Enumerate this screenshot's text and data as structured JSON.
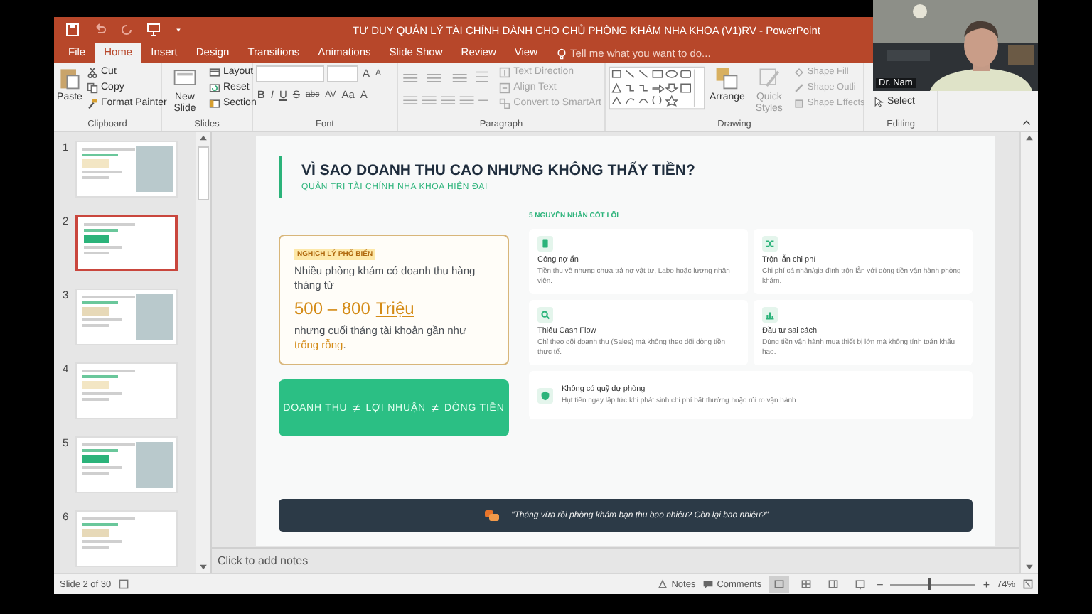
{
  "title_bar": {
    "title": "TƯ DUY QUẢN LÝ TÀI CHÍNH DÀNH CHO CHỦ PHÒNG KHÁM NHA KHOA (V1)RV - PowerPoint"
  },
  "tabs": [
    {
      "label": "File",
      "selected": false
    },
    {
      "label": "Home",
      "selected": true
    },
    {
      "label": "Insert",
      "selected": false
    },
    {
      "label": "Design",
      "selected": false
    },
    {
      "label": "Transitions",
      "selected": false
    },
    {
      "label": "Animations",
      "selected": false
    },
    {
      "label": "Slide Show",
      "selected": false
    },
    {
      "label": "Review",
      "selected": false
    },
    {
      "label": "View",
      "selected": false
    }
  ],
  "tell_me": {
    "placeholder": "Tell me what you want to do..."
  },
  "ribbon": {
    "clipboard": {
      "paste": "Paste",
      "cut": "Cut",
      "copy": "Copy",
      "format_painter": "Format Painter",
      "label": "Clipboard"
    },
    "slides": {
      "new_slide": "New Slide",
      "layout": "Layout",
      "reset": "Reset",
      "section": "Section",
      "label": "Slides"
    },
    "font": {
      "label": "Font",
      "grow": "A",
      "shrink": "A",
      "buttons": [
        "B",
        "I",
        "U",
        "S",
        "abc",
        "AV",
        "Aa",
        "A"
      ]
    },
    "paragraph": {
      "text_direction": "Text Direction",
      "align_text": "Align Text",
      "convert": "Convert to SmartArt",
      "label": "Paragraph"
    },
    "drawing": {
      "arrange": "Arrange",
      "quick_styles": "Quick Styles",
      "shape_fill": "Shape Fill",
      "shape_outline": "Shape Outli",
      "shape_effects": "Shape Effects",
      "label": "Drawing"
    },
    "editing": {
      "select": "Select",
      "label": "Editing"
    }
  },
  "slides_panel": [
    {
      "number": "1",
      "selected": false
    },
    {
      "number": "2",
      "selected": true
    },
    {
      "number": "3",
      "selected": false
    },
    {
      "number": "4",
      "selected": false
    },
    {
      "number": "5",
      "selected": false
    },
    {
      "number": "6",
      "selected": false
    }
  ],
  "slide": {
    "title": "VÌ SAO DOANH THU CAO NHƯNG KHÔNG THẤY TIỀN?",
    "subtitle": "QUẢN TRỊ TÀI CHÍNH NHA KHOA HIỆN ĐẠI",
    "paradox": {
      "badge": "NGHỊCH LÝ PHỔ BIẾN",
      "intro": "Nhiều phòng khám có doanh thu hàng tháng từ",
      "amount": "500 – 800",
      "unit": "Triệu",
      "outro": "nhưng cuối tháng tài khoản gần như **trống rỗng**."
    },
    "equation": {
      "terms": [
        "DOANH THU",
        "LỢI NHUẬN",
        "DÒNG TIỀN"
      ],
      "separators": [
        "≠",
        "≠"
      ]
    },
    "causes_heading": "5 NGUYÊN NHÂN CỐT LÕI",
    "causes": [
      {
        "kind": "card",
        "title": "Công nợ ẩn",
        "text": "Tiền thu về nhưng chưa trả nợ vật tư, Labo hoặc lương nhân viên."
      },
      {
        "kind": "card",
        "title": "Trộn lẫn chi phí",
        "text": "Chi phí cá nhân/gia đình trộn lẫn với dòng tiền vận hành phòng khám."
      },
      {
        "kind": "card",
        "title": "Thiếu Cash Flow",
        "text": "Chỉ theo dõi doanh thu (Sales) mà không theo dõi dòng tiền thực tế."
      },
      {
        "kind": "card",
        "title": "Đầu tư sai cách",
        "text": "Dùng tiền vận hành mua thiết bị lớn mà không tính toán khấu hao."
      },
      {
        "kind": "wide",
        "title": "Không có quỹ dự phòng",
        "text": "Hụt tiền ngay lập tức khi phát sinh chi phí bất thường hoặc rủi ro vận hành."
      }
    ],
    "quote": "\"Tháng vừa rồi phòng khám bạn thu bao nhiêu? Còn lại bao nhiêu?\""
  },
  "notes": {
    "placeholder": "Click to add notes"
  },
  "status_bar": {
    "slide_info": "Slide 2 of 30",
    "notes": "Notes",
    "comments": "Comments",
    "views": [
      {
        "selected": true
      },
      {
        "selected": false
      },
      {
        "selected": false
      },
      {
        "selected": false
      }
    ],
    "zoom_out": "−",
    "zoom_in": "+",
    "zoom": {
      "level": 0.45
    },
    "zoom_percent": "74%"
  },
  "webcam": {
    "name": "Dr. Nam"
  }
}
